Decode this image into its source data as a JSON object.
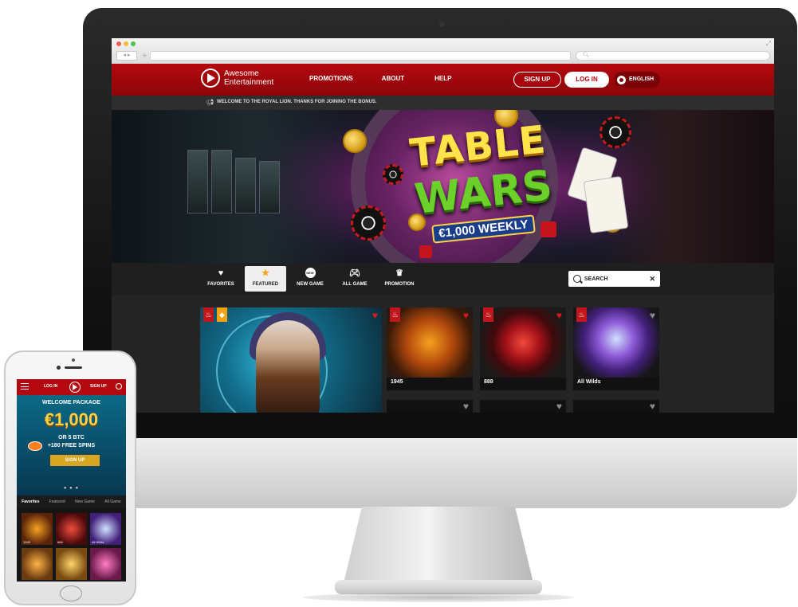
{
  "site": {
    "logo_line1": "Awesome",
    "logo_line2": "Entertainment",
    "nav": [
      "PROMOTIONS",
      "ABOUT",
      "HELP"
    ],
    "signup_label": "SIGN UP",
    "login_label": "LOG IN",
    "language_label": "ENGLISH",
    "ticker_text": "WELCOME TO THE ROYAL LION. THANKS FOR JOINING THE BONUS."
  },
  "banner": {
    "line1": "TABLE",
    "line2": "WARS",
    "line3": "€1,000 WEEKLY"
  },
  "tabs": [
    {
      "label": "FAVORITES",
      "icon": "heart-icon",
      "active": false
    },
    {
      "label": "FEATURED",
      "icon": "star-icon",
      "active": true
    },
    {
      "label": "NEW GAME",
      "icon": "new-badge-icon",
      "active": false
    },
    {
      "label": "ALL GAME",
      "icon": "gamepad-icon",
      "active": false
    },
    {
      "label": "PROMOTION",
      "icon": "crown-icon",
      "active": false
    }
  ],
  "search": {
    "value": "SEARCH"
  },
  "games": [
    {
      "name": "1945",
      "favorite": true
    },
    {
      "name": "888",
      "favorite": true
    },
    {
      "name": "All Wilds",
      "favorite": false
    }
  ],
  "phone": {
    "login_label": "LOG IN",
    "signup_label": "SIGN UP",
    "welcome": "WELCOME PACKAGE",
    "amount": "€1,000",
    "alt_offer": "OR 5 BTC",
    "spins": "+180 FREE SPINS",
    "signup_button": "SIGN UP",
    "tabs": [
      "Favorites",
      "Featured",
      "New Game",
      "All Game"
    ],
    "games_row1": [
      "1945",
      "888",
      "All Wilds"
    ]
  },
  "colors": {
    "brand_red": "#b3080f",
    "accent_gold": "#f2a30f",
    "heart_red": "#e2161c"
  }
}
